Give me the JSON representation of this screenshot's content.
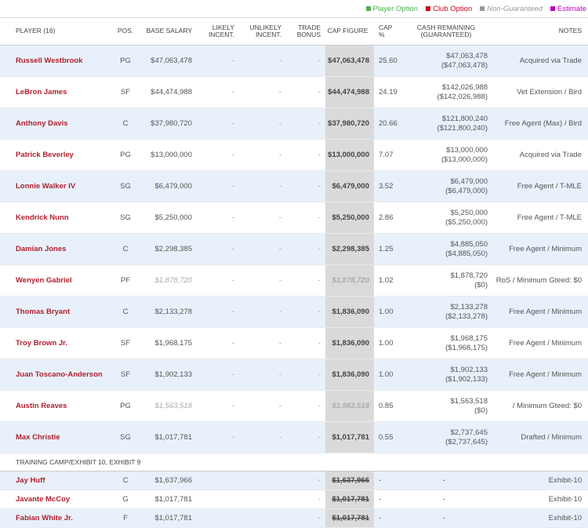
{
  "legend": {
    "player_option": "Player Option",
    "club_option": "Club Option",
    "non_guaranteed": "Non-Guaranteed",
    "estimate": "Estimate",
    "colors": {
      "player_option": "#4caf50",
      "club_option": "#d0021b",
      "non_guaranteed": "#999999",
      "estimate": "#c000c0"
    }
  },
  "headers": {
    "player": "PLAYER (16)",
    "pos": "POS.",
    "base_salary": "BASE SALARY",
    "likely": "LIKELY INCENT.",
    "unlikely": "UNLIKELY INCENT.",
    "trade": "TRADE BONUS",
    "cap_figure": "CAP FIGURE",
    "cap_pct": "CAP %",
    "cash": "CASH REMAINING (GUARANTEED)",
    "notes": "NOTES"
  },
  "players": [
    {
      "name": "Russell Westbrook",
      "pos": "PG",
      "base": "$47,063,478",
      "likely": "-",
      "unlikely": "-",
      "trade": "-",
      "cap": "$47,063,478",
      "pct": "25.60",
      "cash": "$47,063,478",
      "cash_g": "($47,063,478)",
      "notes": "Acquired via Trade",
      "nongtd": false
    },
    {
      "name": "LeBron James",
      "pos": "SF",
      "base": "$44,474,988",
      "likely": "-",
      "unlikely": "-",
      "trade": "-",
      "cap": "$44,474,988",
      "pct": "24.19",
      "cash": "$142,026,988",
      "cash_g": "($142,026,988)",
      "notes": "Vet Extension / Bird",
      "nongtd": false
    },
    {
      "name": "Anthony Davis",
      "pos": "C",
      "base": "$37,980,720",
      "likely": "-",
      "unlikely": "-",
      "trade": "-",
      "cap": "$37,980,720",
      "pct": "20.66",
      "cash": "$121,800,240",
      "cash_g": "($121,800,240)",
      "notes": "Free Agent (Max) / Bird",
      "nongtd": false
    },
    {
      "name": "Patrick Beverley",
      "pos": "PG",
      "base": "$13,000,000",
      "likely": "-",
      "unlikely": "-",
      "trade": "-",
      "cap": "$13,000,000",
      "pct": "7.07",
      "cash": "$13,000,000",
      "cash_g": "($13,000,000)",
      "notes": "Acquired via Trade",
      "nongtd": false
    },
    {
      "name": "Lonnie Walker IV",
      "pos": "SG",
      "base": "$6,479,000",
      "likely": "-",
      "unlikely": "-",
      "trade": "-",
      "cap": "$6,479,000",
      "pct": "3.52",
      "cash": "$6,479,000",
      "cash_g": "($6,479,000)",
      "notes": "Free Agent / T-MLE",
      "nongtd": false
    },
    {
      "name": "Kendrick Nunn",
      "pos": "SG",
      "base": "$5,250,000",
      "likely": "-",
      "unlikely": "-",
      "trade": "-",
      "cap": "$5,250,000",
      "pct": "2.86",
      "cash": "$5,250,000",
      "cash_g": "($5,250,000)",
      "notes": "Free Agent / T-MLE",
      "nongtd": false
    },
    {
      "name": "Damian Jones",
      "pos": "C",
      "base": "$2,298,385",
      "likely": "-",
      "unlikely": "-",
      "trade": "-",
      "cap": "$2,298,385",
      "pct": "1.25",
      "cash": "$4,885,050",
      "cash_g": "($4,885,050)",
      "notes": "Free Agent / Minimum",
      "nongtd": false
    },
    {
      "name": "Wenyen Gabriel",
      "pos": "PF",
      "base": "$1,878,720",
      "likely": "-",
      "unlikely": "-",
      "trade": "-",
      "cap": "$1,878,720",
      "pct": "1.02",
      "cash": "$1,878,720",
      "cash_g": "($0)",
      "notes": "RoS / Minimum Gteed: $0",
      "nongtd": true
    },
    {
      "name": "Thomas Bryant",
      "pos": "C",
      "base": "$2,133,278",
      "likely": "-",
      "unlikely": "-",
      "trade": "-",
      "cap": "$1,836,090",
      "pct": "1.00",
      "cash": "$2,133,278",
      "cash_g": "($2,133,278)",
      "notes": "Free Agent / Minimum",
      "nongtd": false
    },
    {
      "name": "Troy Brown Jr.",
      "pos": "SF",
      "base": "$1,968,175",
      "likely": "-",
      "unlikely": "-",
      "trade": "-",
      "cap": "$1,836,090",
      "pct": "1.00",
      "cash": "$1,968,175",
      "cash_g": "($1,968,175)",
      "notes": "Free Agent / Minimum",
      "nongtd": false
    },
    {
      "name": "Juan Toscano-Anderson",
      "pos": "SF",
      "base": "$1,902,133",
      "likely": "-",
      "unlikely": "-",
      "trade": "-",
      "cap": "$1,836,090",
      "pct": "1.00",
      "cash": "$1,902,133",
      "cash_g": "($1,902,133)",
      "notes": "Free Agent / Minimum",
      "nongtd": false
    },
    {
      "name": "Austin Reaves",
      "pos": "PG",
      "base": "$1,563,518",
      "likely": "-",
      "unlikely": "-",
      "trade": "-",
      "cap": "$1,563,518",
      "pct": "0.85",
      "cash": "$1,563,518",
      "cash_g": "($0)",
      "notes": "/ Minimum Gteed: $0",
      "nongtd": true
    },
    {
      "name": "Max Christie",
      "pos": "SG",
      "base": "$1,017,781",
      "likely": "-",
      "unlikely": "-",
      "trade": "-",
      "cap": "$1,017,781",
      "pct": "0.55",
      "cash": "$2,737,645",
      "cash_g": "($2,737,645)",
      "notes": "Drafted / Minimum",
      "nongtd": false
    }
  ],
  "training_camp": {
    "label": "TRAINING CAMP/EXHIBIT 10, EXHIBIT 9",
    "players": [
      {
        "name": "Jay Huff",
        "pos": "C",
        "base": "$1,637,966",
        "trade": "-",
        "cap": "$1,637,966",
        "pct": "-",
        "cash": "-",
        "notes": "Exhibit-10"
      },
      {
        "name": "Javante McCoy",
        "pos": "G",
        "base": "$1,017,781",
        "trade": "-",
        "cap": "$1,017,781",
        "pct": "-",
        "cash": "-",
        "notes": "Exhibit-10"
      },
      {
        "name": "Fabian White Jr.",
        "pos": "F",
        "base": "$1,017,781",
        "trade": "-",
        "cap": "$1,017,781",
        "pct": "-",
        "cash": "-",
        "notes": "Exhibit-10"
      }
    ]
  }
}
